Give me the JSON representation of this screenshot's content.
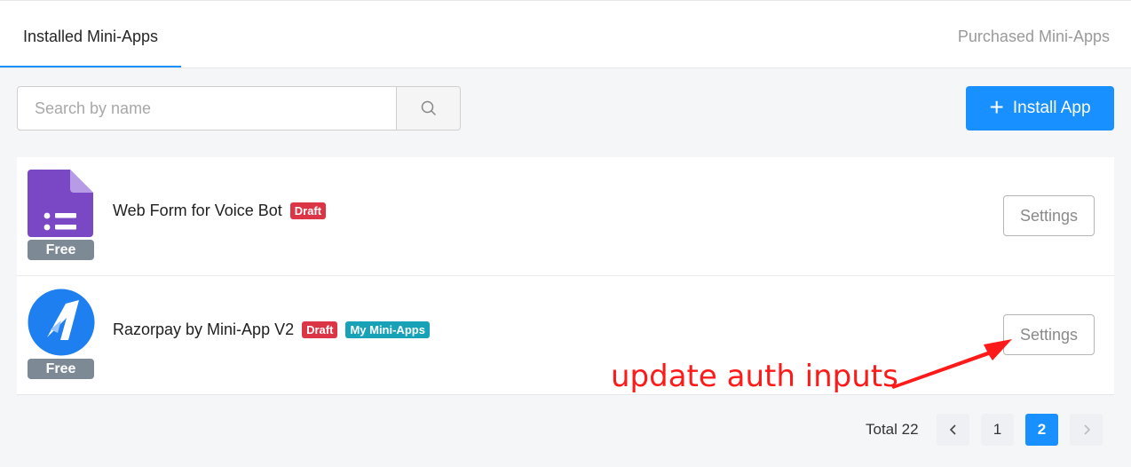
{
  "tabs": {
    "installed": "Installed Mini-Apps",
    "purchased": "Purchased Mini-Apps"
  },
  "search": {
    "placeholder": "Search by name",
    "value": ""
  },
  "install_button": {
    "label": "Install App"
  },
  "apps": [
    {
      "name": "Web Form for Voice Bot",
      "price_badge": "Free",
      "tags": [
        "Draft"
      ],
      "action": "Settings",
      "icon": "form-icon"
    },
    {
      "name": "Razorpay by Mini-App V2",
      "price_badge": "Free",
      "tags": [
        "Draft",
        "My Mini-Apps"
      ],
      "action": "Settings",
      "icon": "razorpay-logo-icon"
    }
  ],
  "annotation": "update auth inputs",
  "pagination": {
    "total": "Total 22",
    "pages": [
      "1",
      "2"
    ],
    "current": "2"
  },
  "colors": {
    "primary": "#1890ff",
    "draft_tag": "#dc3545",
    "my_miniapps_tag": "#17a2b8",
    "free_badge": "#7d8a96",
    "annotation": "#ff1a1a",
    "form_icon": "#7b48c5"
  }
}
